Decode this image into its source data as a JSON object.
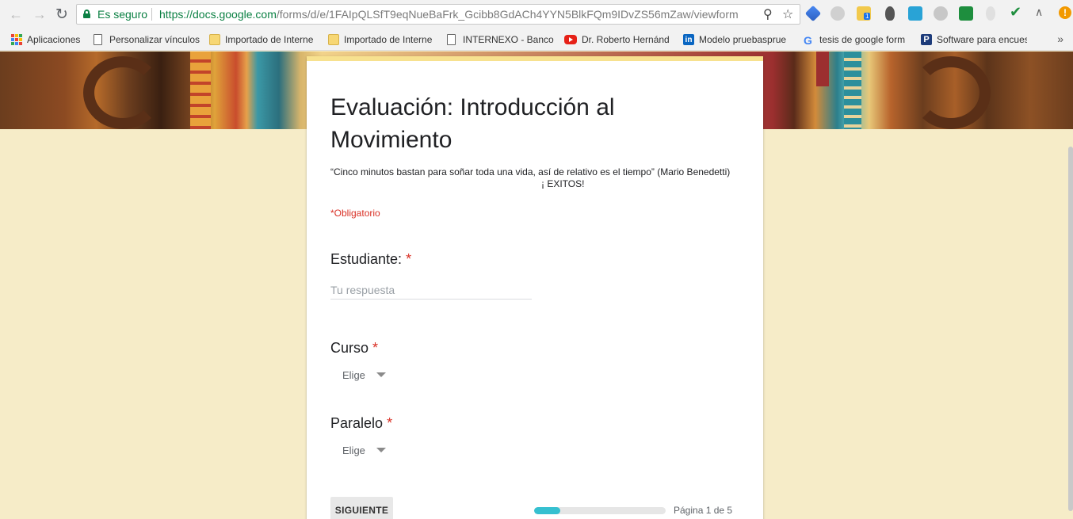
{
  "browser": {
    "secure_label": "Es seguro",
    "url_host": "https://docs.google.com",
    "url_path": "/forms/d/e/1FAIpQLSfT9eqNueBaFrk_Gcibb8GdACh4YYN5BlkFQm9IDvZS56mZaw/viewform",
    "extension_badge": "1"
  },
  "bookmarks": [
    {
      "label": "Aplicaciones",
      "icon": "apps-grid-icon"
    },
    {
      "label": "Personalizar vínculos",
      "icon": "page-icon"
    },
    {
      "label": "Importado de Interne",
      "icon": "folder-icon"
    },
    {
      "label": "Importado de Interne",
      "icon": "folder-icon"
    },
    {
      "label": "INTERNEXO - Banco",
      "icon": "page-icon"
    },
    {
      "label": "Dr. Roberto Hernánd",
      "icon": "youtube-icon"
    },
    {
      "label": "Modelo pruebasprue",
      "icon": "linkedin-icon"
    },
    {
      "label": "tesis de google form",
      "icon": "google-icon"
    },
    {
      "label": "Software para encues",
      "icon": "p-icon"
    }
  ],
  "bookmarks_more": "»",
  "form": {
    "title": "Evaluación: Introducción al Movimiento",
    "description_line1": "“Cinco minutos bastan para soñar toda una vida,  así de relativo es el tiempo”  (Mario Benedetti)",
    "description_line2": "¡ EXITOS!",
    "required_note": "*Obligatorio",
    "questions": [
      {
        "label": "Estudiante:",
        "required_mark": "*",
        "type": "text",
        "placeholder": "Tu respuesta"
      },
      {
        "label": "Curso",
        "required_mark": "*",
        "type": "select",
        "selected": "Elige"
      },
      {
        "label": "Paralelo",
        "required_mark": "*",
        "type": "select",
        "selected": "Elige"
      }
    ],
    "next_button": "SIGUIENTE",
    "progress_fraction": 0.2,
    "page_indicator": "Página 1 de 5"
  },
  "colors": {
    "secure_green": "#0b8043",
    "required_red": "#d93025",
    "progress_teal": "#36c0d0",
    "page_background": "#f6ecc8"
  }
}
